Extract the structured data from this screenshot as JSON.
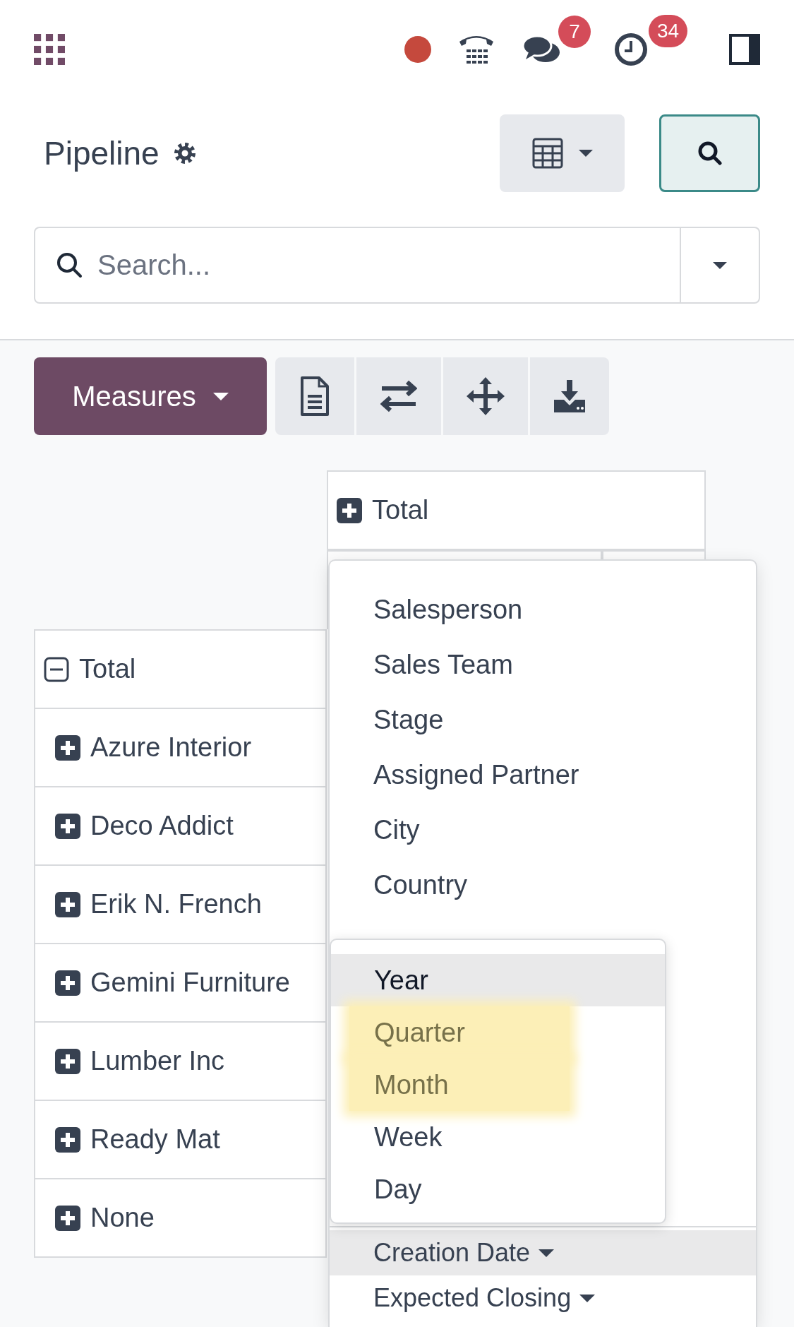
{
  "topbar": {
    "messages_badge": "7",
    "activities_badge": "34"
  },
  "control_panel": {
    "title": "Pipeline",
    "search": {
      "placeholder": "Search..."
    }
  },
  "toolbar": {
    "measures": "Measures"
  },
  "pivot": {
    "column_header": {
      "label": "Total",
      "expanded": false
    },
    "row_header": {
      "label": "Total",
      "expanded": true
    },
    "rows": [
      {
        "label": "Azure Interior",
        "expanded": false
      },
      {
        "label": "Deco Addict",
        "expanded": false
      },
      {
        "label": "Erik N. French",
        "expanded": false
      },
      {
        "label": "Gemini Furniture",
        "expanded": false
      },
      {
        "label": "Lumber Inc",
        "expanded": false
      },
      {
        "label": "Ready Mat",
        "expanded": false
      },
      {
        "label": "None",
        "expanded": false
      }
    ]
  },
  "group_by_menu": {
    "items": [
      {
        "label": "Salesperson",
        "kind": "field",
        "selected": false
      },
      {
        "label": "Sales Team",
        "kind": "field",
        "selected": false
      },
      {
        "label": "Stage",
        "kind": "field",
        "selected": false
      },
      {
        "label": "Assigned Partner",
        "kind": "field",
        "selected": false
      },
      {
        "label": "City",
        "kind": "field",
        "selected": false
      },
      {
        "label": "Country",
        "kind": "field",
        "selected": false
      },
      {
        "label": "Creation Date",
        "kind": "date",
        "selected": true
      },
      {
        "label": "Expected Closing",
        "kind": "date",
        "selected": false
      }
    ],
    "submenu": {
      "items": [
        {
          "label": "Year",
          "selected": true,
          "highlighted": false
        },
        {
          "label": "Quarter",
          "selected": false,
          "highlighted": true
        },
        {
          "label": "Month",
          "selected": false,
          "highlighted": true
        },
        {
          "label": "Week",
          "selected": false,
          "highlighted": false
        },
        {
          "label": "Day",
          "selected": false,
          "highlighted": false
        }
      ]
    }
  }
}
